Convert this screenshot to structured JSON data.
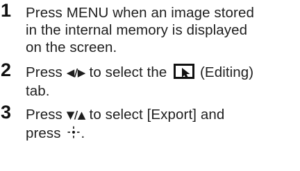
{
  "steps": [
    {
      "number": "1",
      "lines": [
        "Press MENU when an image stored",
        "in the internal memory is displayed",
        "on the screen."
      ]
    },
    {
      "number": "2",
      "line1_before": "Press ",
      "line1_arrows": "◀/▶",
      "line1_mid": " to select the ",
      "line1_after": " (Editing)",
      "line2": "tab.",
      "icon": "editing-tab-icon"
    },
    {
      "number": "3",
      "line1_before": "Press ",
      "line1_arrows": "▼/▲",
      "line1_after": " to select [Export] and",
      "line2_before": "press ",
      "line2_after": ".",
      "icon": "control-button-center-icon"
    }
  ]
}
